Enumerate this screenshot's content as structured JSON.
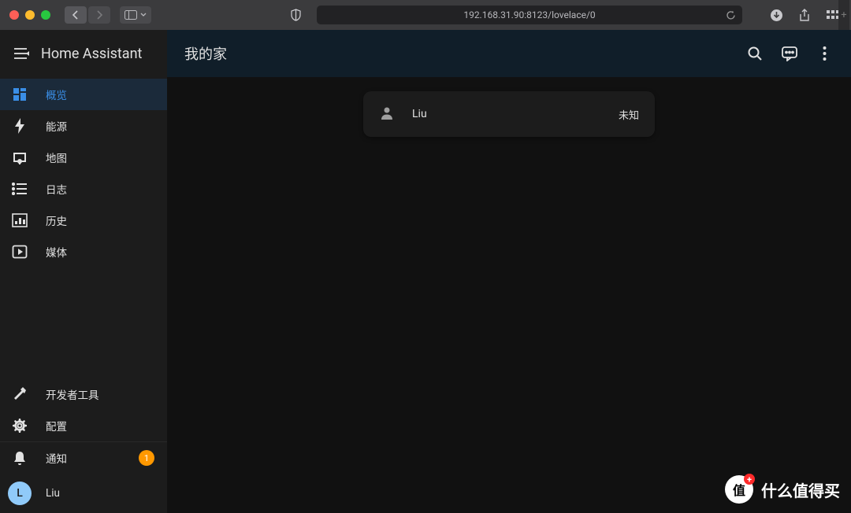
{
  "browser": {
    "url": "192.168.31.90:8123/lovelace/0"
  },
  "sidebar": {
    "title": "Home Assistant",
    "items": [
      {
        "label": "概览",
        "icon": "dashboard",
        "active": true
      },
      {
        "label": "能源",
        "icon": "flash"
      },
      {
        "label": "地图",
        "icon": "map"
      },
      {
        "label": "日志",
        "icon": "list"
      },
      {
        "label": "历史",
        "icon": "chart"
      },
      {
        "label": "媒体",
        "icon": "play"
      }
    ],
    "tools": [
      {
        "label": "开发者工具",
        "icon": "wrench"
      },
      {
        "label": "配置",
        "icon": "cog"
      }
    ],
    "bottom": {
      "notification_label": "通知",
      "notification_count": "1",
      "user_label": "Liu",
      "user_initial": "L"
    }
  },
  "topbar": {
    "title": "我的家"
  },
  "card": {
    "name": "Liu",
    "state": "未知"
  },
  "watermark": {
    "text": "什么值得买",
    "badge": "值"
  }
}
